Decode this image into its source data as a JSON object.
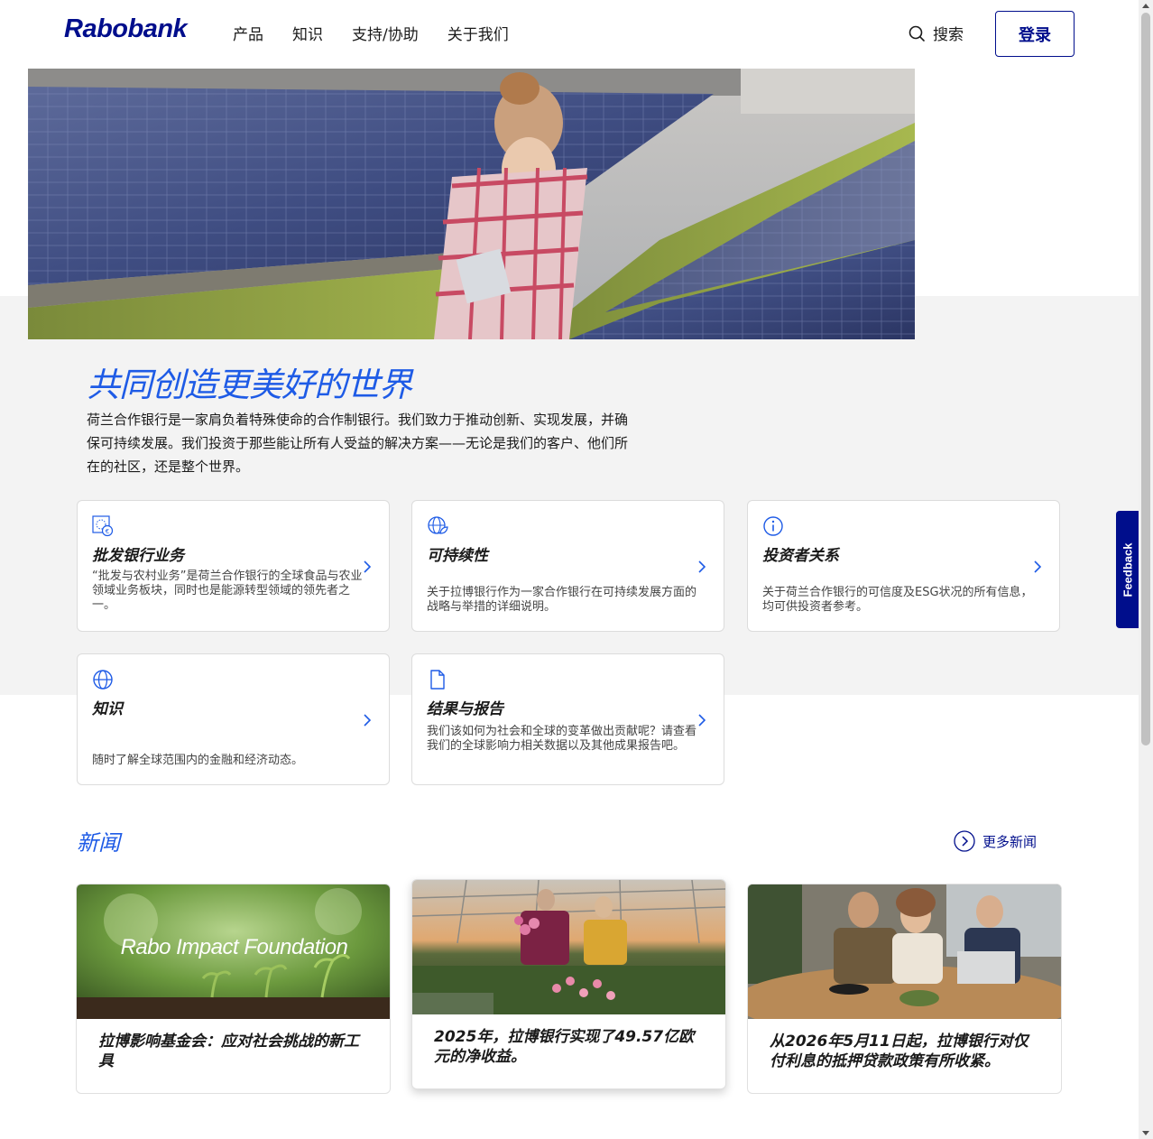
{
  "header": {
    "logo": "Rabobank",
    "nav": [
      "产品",
      "知识",
      "支持/协助",
      "关于我们"
    ],
    "search_label": "搜索",
    "login_label": "登录"
  },
  "hero": {
    "title": "共同创造更美好的世界",
    "description": "荷兰合作银行是一家肩负着特殊使命的合作制银行。我们致力于推动创新、实现发展，并确保可持续发展。我们投资于那些能让所有人受益的解决方案——无论是我们的客户、他们所在的社区，还是整个世界。"
  },
  "cards": [
    {
      "icon": "euro-globe-icon",
      "title": "批发银行业务",
      "desc": "“批发与农村业务”是荷兰合作银行的全球食品与农业领域业务板块，同时也是能源转型领域的领先者之一。"
    },
    {
      "icon": "leaf-globe-icon",
      "title": "可持续性",
      "desc": "关于拉博银行作为一家合作银行在可持续发展方面的战略与举措的详细说明。"
    },
    {
      "icon": "info-icon",
      "title": "投资者关系",
      "desc": "关于荷兰合作银行的可信度及ESG状况的所有信息，均可供投资者参考。"
    },
    {
      "icon": "globe-icon",
      "title": "知识",
      "desc": "随时了解全球范围内的金融和经济动态。"
    },
    {
      "icon": "document-icon",
      "title": "结果与报告",
      "desc": "我们该如何为社会和全球的变革做出贡献呢？请查看我们的全球影响力相关数据以及其他成果报告吧。"
    }
  ],
  "news": {
    "title": "新闻",
    "more_label": "更多新闻",
    "items": [
      {
        "image_caption": "Rabo Impact Foundation",
        "headline": "拉博影响基金会：应对社会挑战的新工具"
      },
      {
        "headline": "2025年，拉博银行实现了49.57亿欧元的净收益。"
      },
      {
        "headline": "从2026年5月11日起，拉博银行对仅付利息的抵押贷款政策有所收紧。"
      }
    ]
  },
  "feedback_label": "Feedback",
  "colors": {
    "brand_navy": "#000e8c",
    "accent_blue": "#1e5be6",
    "band_grey": "#f3f3f3"
  }
}
